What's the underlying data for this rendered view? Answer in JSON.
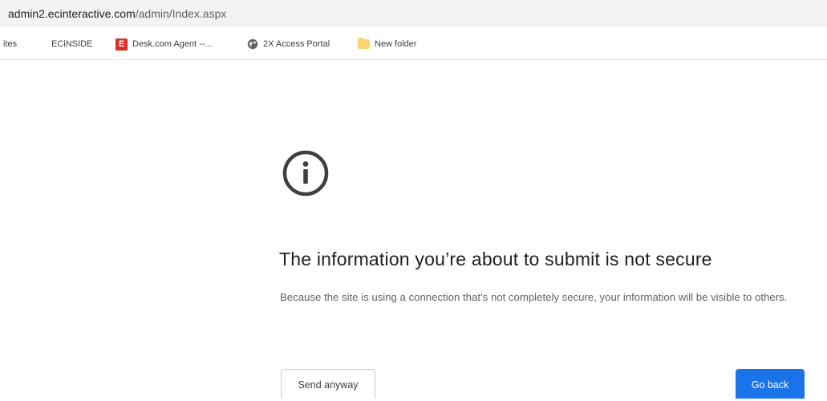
{
  "address_bar": {
    "host": "admin2.ecinteractive.com",
    "path": "/admin/Index.aspx"
  },
  "bookmarks": [
    {
      "label": "ites",
      "icon": "none"
    },
    {
      "label": "ECiNSIDE",
      "icon": "windows-logo-icon"
    },
    {
      "label": "Desk.com Agent --...",
      "icon": "desk-e-icon"
    },
    {
      "label": "2X Access Portal",
      "icon": "globe-icon"
    },
    {
      "label": "New folder",
      "icon": "folder-icon"
    }
  ],
  "dialog": {
    "icon": "info-circle-icon",
    "title": "The information you’re about to submit is not secure",
    "body": "Because the site is using a connection that’s not completely secure, your information will be visible to others.",
    "secondary_button": "Send anyway",
    "primary_button": "Go back"
  },
  "colors": {
    "primary": "#1a73e8",
    "text": "#202124",
    "secondary_text": "#5f6368"
  }
}
